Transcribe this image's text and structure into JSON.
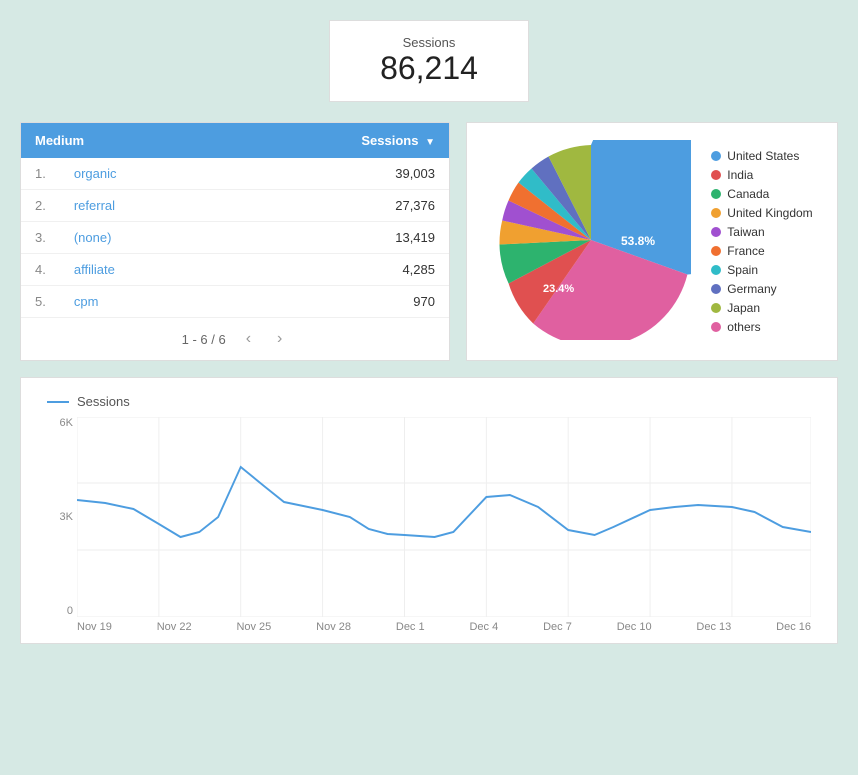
{
  "sessions_box": {
    "label": "Sessions",
    "value": "86,214"
  },
  "medium_table": {
    "header_medium": "Medium",
    "header_sessions": "Sessions",
    "rows": [
      {
        "rank": "1.",
        "medium": "organic",
        "sessions": "39,003"
      },
      {
        "rank": "2.",
        "medium": "referral",
        "sessions": "27,376"
      },
      {
        "rank": "3.",
        "medium": "(none)",
        "sessions": "13,419"
      },
      {
        "rank": "4.",
        "medium": "affiliate",
        "sessions": "4,285"
      },
      {
        "rank": "5.",
        "medium": "cpm",
        "sessions": "970"
      }
    ],
    "pagination": "1 - 6 / 6"
  },
  "pie_chart": {
    "legend": [
      {
        "label": "United States",
        "color": "#4d9de0",
        "pct": 53.8
      },
      {
        "label": "India",
        "color": "#e05050"
      },
      {
        "label": "Canada",
        "color": "#2db36e"
      },
      {
        "label": "United Kingdom",
        "color": "#f0a030"
      },
      {
        "label": "Taiwan",
        "color": "#a050d0"
      },
      {
        "label": "France",
        "color": "#f07030"
      },
      {
        "label": "Spain",
        "color": "#30bcc8"
      },
      {
        "label": "Germany",
        "color": "#6070c0"
      },
      {
        "label": "Japan",
        "color": "#a0b840"
      },
      {
        "label": "others",
        "color": "#e060a0"
      }
    ],
    "label_us": "53.8%",
    "label_others": "23.4%"
  },
  "line_chart": {
    "title": "Sessions",
    "y_labels": [
      "6K",
      "3K",
      "0"
    ],
    "x_labels": [
      "Nov 19",
      "Nov 22",
      "Nov 25",
      "Nov 28",
      "Dec 1",
      "Dec 4",
      "Dec 7",
      "Dec 10",
      "Dec 13",
      "Dec 16"
    ]
  }
}
